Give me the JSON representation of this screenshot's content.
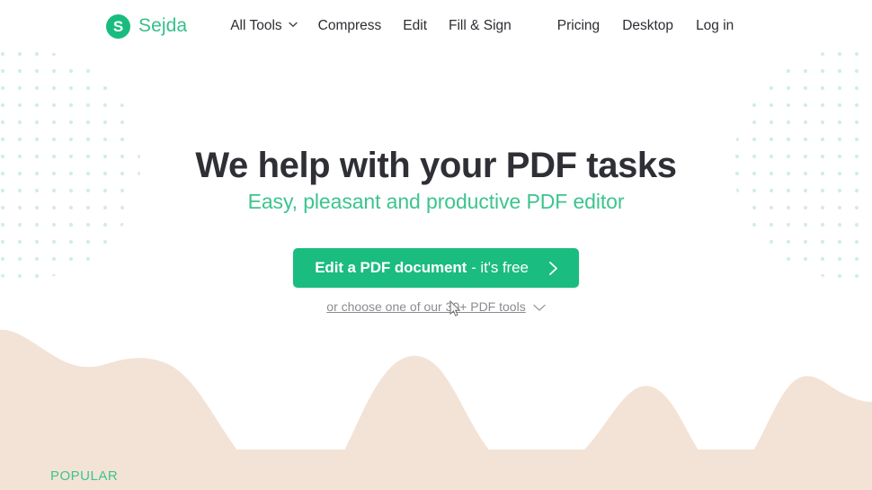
{
  "brand": {
    "mark_letter": "S",
    "name": "Sejda",
    "mark_color": "#19BC7E",
    "name_color": "#35C08A"
  },
  "nav": {
    "main_items": [
      {
        "label": "All Tools",
        "has_caret": true
      },
      {
        "label": "Compress",
        "has_caret": false
      },
      {
        "label": "Edit",
        "has_caret": false
      },
      {
        "label": "Fill & Sign",
        "has_caret": false
      }
    ],
    "right_items": [
      {
        "label": "Pricing"
      },
      {
        "label": "Desktop"
      },
      {
        "label": "Log in"
      }
    ]
  },
  "hero": {
    "title": "We help with your PDF tasks",
    "subtitle": "Easy, pleasant and productive PDF editor",
    "subtitle_color": "#3DC48E",
    "title_color": "#2f3035"
  },
  "cta": {
    "strong_label": "Edit a PDF document",
    "light_label": "- it's free",
    "arrow_icon": "chevron-right-icon",
    "background_color": "#1BBC80",
    "text_color": "#ffffff"
  },
  "sub_cta": {
    "label": "or choose one of our 30+ PDF tools",
    "chevron_icon": "chevron-down-icon",
    "color": "#8b8b91"
  },
  "sections": {
    "popular_label": "POPULAR",
    "popular_color": "#3DC48E"
  },
  "decoration": {
    "dot_color": "#D8EFE4",
    "wave_color": "#F3E3D6"
  }
}
